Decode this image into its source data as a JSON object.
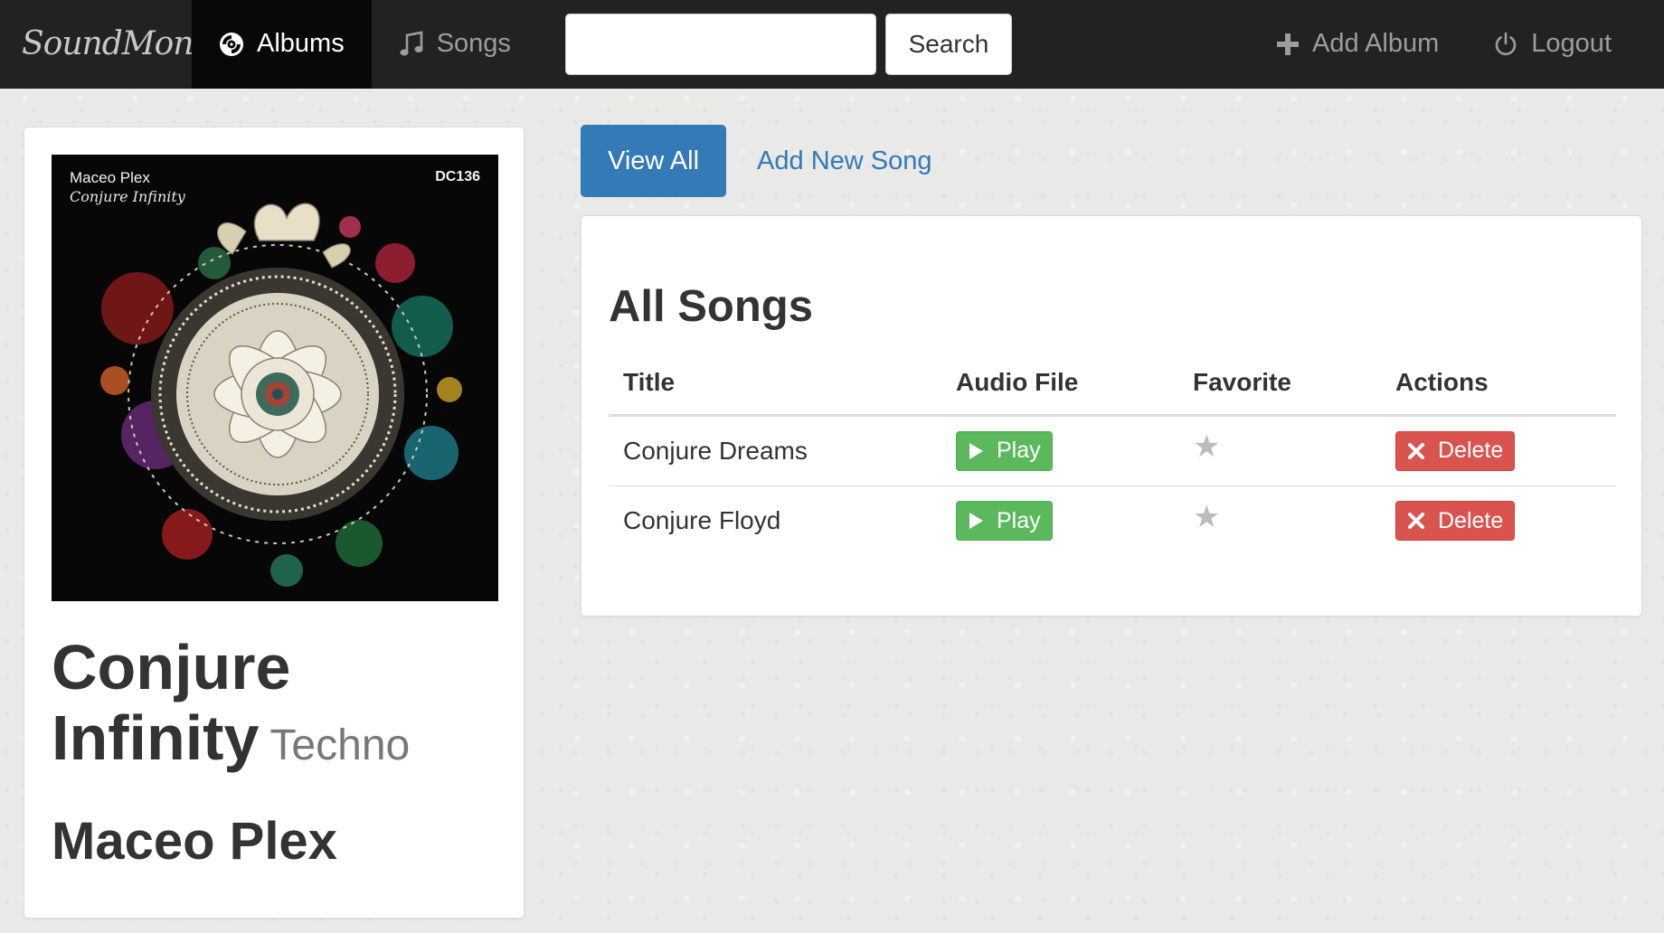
{
  "navbar": {
    "brand": "SoundMonk",
    "items": [
      {
        "label": "Albums",
        "icon": "disc-icon",
        "active": true
      },
      {
        "label": "Songs",
        "icon": "music-note-icon",
        "active": false
      }
    ],
    "search": {
      "placeholder": "",
      "value": "",
      "button_label": "Search"
    },
    "right": [
      {
        "label": "Add Album",
        "icon": "plus-icon"
      },
      {
        "label": "Logout",
        "icon": "power-icon"
      }
    ]
  },
  "album": {
    "cover": {
      "artist": "Maceo Plex",
      "title": "Conjure Infinity",
      "code": "DC136"
    },
    "title": "Conjure Infinity",
    "genre": "Techno",
    "artist": "Maceo Plex"
  },
  "tabs": {
    "view_all": "View All",
    "add_new_song": "Add New Song"
  },
  "songs": {
    "heading": "All Songs",
    "columns": [
      "Title",
      "Audio File",
      "Favorite",
      "Actions"
    ],
    "rows": [
      {
        "title": "Conjure Dreams",
        "play_label": "Play",
        "favorite": false,
        "delete_label": "Delete"
      },
      {
        "title": "Conjure Floyd",
        "play_label": "Play",
        "favorite": false,
        "delete_label": "Delete"
      }
    ]
  },
  "colors": {
    "navbar_bg": "#222222",
    "primary": "#337ab7",
    "success": "#5cb85c",
    "danger": "#d9534f"
  }
}
